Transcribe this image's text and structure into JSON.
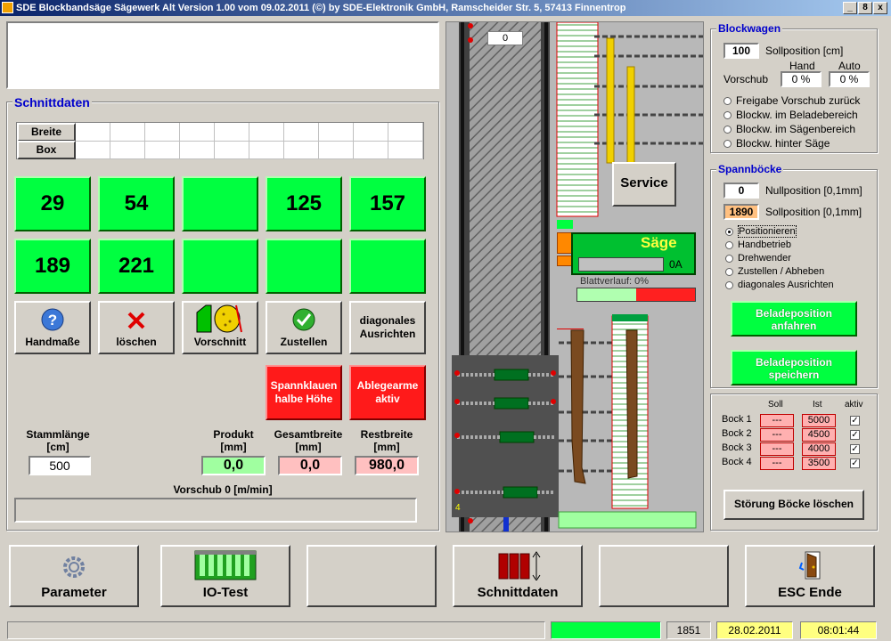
{
  "window": {
    "title": "SDE Blockbandsäge Sägewerk Alt   Version 1.00 vom 09.02.2011   (©) by SDE-Elektronik GmbH, Ramscheider Str. 5, 57413 Finnentrop",
    "min": "_",
    "max": "8",
    "close": "x"
  },
  "schnittdaten": {
    "legend": "Schnittdaten",
    "row_breite": "Breite",
    "row_box": "Box",
    "cells_top": [
      "29",
      "54",
      "",
      "125",
      "157"
    ],
    "cells_bottom": [
      "189",
      "221",
      "",
      "",
      ""
    ],
    "tools": [
      {
        "label": "Handmaße",
        "icon": "help-icon"
      },
      {
        "label": "löschen",
        "icon": "delete-icon"
      },
      {
        "label": "Vorschnitt",
        "icon": "log-icon"
      },
      {
        "label": "Zustellen",
        "icon": "check-icon"
      },
      {
        "label": "diagonales Ausrichten",
        "icon": ""
      }
    ],
    "red_btn1": "Spannklauen halbe Höhe",
    "red_btn2": "Ablegearme aktiv",
    "stammlaenge_label": "Stammlänge [cm]",
    "stammlaenge": "500",
    "produkt_label": "Produkt [mm]",
    "produkt": "0,0",
    "gesamtbreite_label": "Gesamtbreite [mm]",
    "gesamtbreite": "0,0",
    "restbreite_label": "Restbreite [mm]",
    "restbreite": "980,0",
    "vorschub_label": "Vorschub 0 [m/min]"
  },
  "visual": {
    "pos_top": "0",
    "service": "Service",
    "saege": "Säge",
    "saege_amp": "0A",
    "blattverlauf": "Blattverlauf: 0%",
    "corner": "4"
  },
  "blockwagen": {
    "legend": "Blockwagen",
    "sollposition_value": "100",
    "sollposition_label": "Sollposition [cm]",
    "hand_label": "Hand",
    "auto_label": "Auto",
    "vorschub_label": "Vorschub",
    "hand_value": "0 %",
    "auto_value": "0 %",
    "status": [
      "Freigabe Vorschub zurück",
      "Blockw. im Beladebereich",
      "Blockw. im Sägenbereich",
      "Blockw. hinter Säge"
    ]
  },
  "spannboecke": {
    "legend": "Spannböcke",
    "nullposition_value": "0",
    "nullposition_label": "Nullposition [0,1mm]",
    "sollposition_value": "1890",
    "sollposition_label": "Sollposition [0,1mm]",
    "modes": [
      "Positionieren",
      "Handbetrieb",
      "Drehwender",
      "Zustellen / Abheben",
      "diagonales Ausrichten"
    ],
    "selected_mode": "Positionieren",
    "btn_anfahren": "Beladeposition anfahren",
    "btn_speichern": "Beladeposition speichern"
  },
  "boecke": {
    "head_soll": "Soll",
    "head_ist": "Ist",
    "head_aktiv": "aktiv",
    "rows": [
      {
        "name": "Bock 1",
        "soll": "---",
        "ist": "5000",
        "aktiv": true
      },
      {
        "name": "Bock 2",
        "soll": "---",
        "ist": "4500",
        "aktiv": true
      },
      {
        "name": "Bock 3",
        "soll": "---",
        "ist": "4000",
        "aktiv": true
      },
      {
        "name": "Bock 4",
        "soll": "---",
        "ist": "3500",
        "aktiv": true
      }
    ],
    "btn_stoerung": "Störung Böcke löschen"
  },
  "bottom": {
    "parameter": "Parameter",
    "iotest": "IO-Test",
    "schnittdaten": "Schnittdaten",
    "esc": "ESC Ende"
  },
  "statusbar": {
    "counter": "1851",
    "date": "28.02.2011",
    "time": "08:01:44"
  },
  "colors": {
    "accent_green": "#00ff40",
    "alarm_red": "#ff1a1a",
    "legend_blue": "#0000cc"
  }
}
